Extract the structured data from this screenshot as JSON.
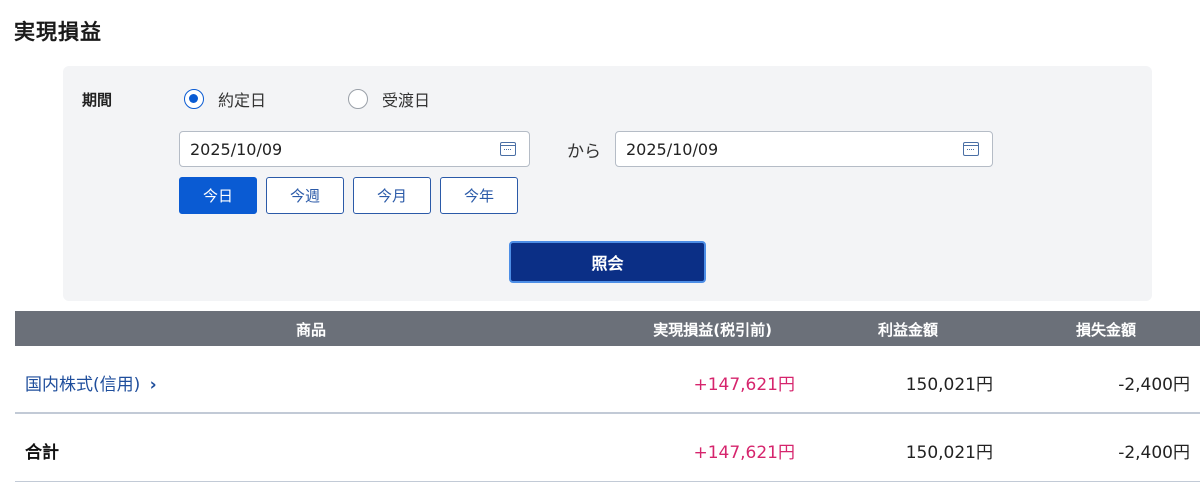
{
  "page": {
    "title": "実現損益"
  },
  "filter": {
    "period_label": "期間",
    "radios": [
      {
        "label": "約定日",
        "checked": true
      },
      {
        "label": "受渡日",
        "checked": false
      }
    ],
    "date_from": "2025/10/09",
    "date_to": "2025/10/09",
    "from_text": "から",
    "quick_buttons": [
      {
        "label": "今日",
        "active": true
      },
      {
        "label": "今週",
        "active": false
      },
      {
        "label": "今月",
        "active": false
      },
      {
        "label": "今年",
        "active": false
      }
    ],
    "query_button": "照会"
  },
  "table": {
    "headers": {
      "product": "商品",
      "realized_pl": "実現損益(税引前)",
      "profit": "利益金額",
      "loss": "損失金額"
    },
    "rows": [
      {
        "product": "国内株式(信用)",
        "chevron": "›",
        "realized_pl": "+147,621円",
        "profit": "150,021円",
        "loss": "-2,400円"
      }
    ],
    "total": {
      "label": "合計",
      "realized_pl": "+147,621円",
      "profit": "150,021円",
      "loss": "-2,400円"
    }
  },
  "colors": {
    "accent": "#0a5bd3",
    "primary_button": "#0b2f86",
    "header_bg": "#6b7079",
    "positive_pl": "#d6256d",
    "link": "#1f4e9c"
  }
}
